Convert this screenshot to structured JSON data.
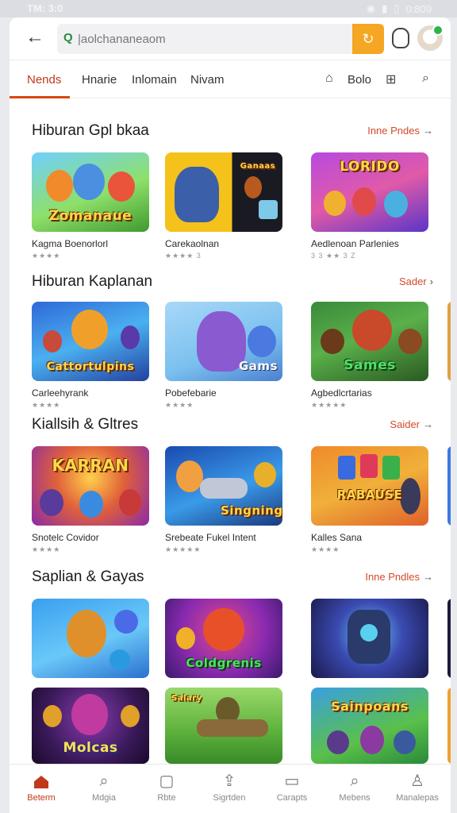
{
  "status_bar": {
    "time": "TM: 3:0",
    "clock": "0:809"
  },
  "browser": {
    "address": "|aolchananeaom",
    "address_icon": "Q"
  },
  "tabs": [
    {
      "label": "Nends",
      "active": true
    },
    {
      "label": "Hnarie",
      "active": false
    },
    {
      "label": "Inlomain",
      "active": false
    },
    {
      "label": "Nivam",
      "active": false
    }
  ],
  "tab_tools": {
    "home_label": "Bolo"
  },
  "sections": [
    {
      "title": "Hiburan Gpl bkaa",
      "link": "Inne Pndes",
      "cards": [
        {
          "title": "Kagma Boenorlorl",
          "rating": "★★★★",
          "art": "Zomanaue",
          "icon": "kingdom-game-icon"
        },
        {
          "title": "Carekaolnan",
          "rating": "★★★★ 3",
          "art": "Ganaas",
          "icon": "wolf-game-icon"
        },
        {
          "title": "Aedlenoan Parlenies",
          "rating": "3 3 ★★ 3 Z",
          "art": "LORIDO",
          "icon": "party-game-icon"
        }
      ]
    },
    {
      "title": "Hiburan Kaplanan",
      "link": "Sader",
      "cards": [
        {
          "title": "Carleehyrank",
          "rating": "★★★★",
          "art": "Cattortulpins",
          "icon": "hero-game-icon"
        },
        {
          "title": "Pobefebarie",
          "rating": "★★★★",
          "art": "Gams",
          "icon": "cat-game-icon"
        },
        {
          "title": "Agbedlcrtarias",
          "rating": "★★★★★",
          "art": "Sames",
          "icon": "dragon-game-icon"
        }
      ]
    },
    {
      "title": "Kiallsih & Gltres",
      "link": "Saider",
      "cards": [
        {
          "title": "Snotelc Covidor",
          "rating": "★★★★",
          "art": "KARRAN",
          "icon": "arena-game-icon"
        },
        {
          "title": "Srebeate Fukel Intent",
          "rating": "★★★★★",
          "art": "Singning",
          "icon": "cannon-game-icon"
        },
        {
          "title": "Kalles Sana",
          "rating": "★★★★",
          "art": "RABAUSE",
          "icon": "cards-game-icon"
        }
      ]
    },
    {
      "title": "Saplian & Gayas",
      "link": "Inne Pndles",
      "cards": [
        {
          "title": "",
          "rating": "",
          "art": "",
          "icon": "squirrel-game-icon"
        },
        {
          "title": "",
          "rating": "",
          "art": "Coldgrenis",
          "icon": "monster-game-icon"
        },
        {
          "title": "",
          "rating": "",
          "art": "",
          "icon": "robot-game-icon"
        },
        {
          "title": "",
          "rating": "",
          "art": "Molcas",
          "icon": "witch-game-icon"
        },
        {
          "title": "",
          "rating": "",
          "art": "Salary",
          "icon": "soldier-game-icon"
        },
        {
          "title": "",
          "rating": "",
          "art": "Sainpoans",
          "icon": "battle-game-icon"
        }
      ]
    }
  ],
  "bottom_nav": [
    {
      "label": "Beterm",
      "icon": "home-icon",
      "active": true
    },
    {
      "label": "Mdgia",
      "icon": "search-icon",
      "active": false
    },
    {
      "label": "Rbte",
      "icon": "page-icon",
      "active": false
    },
    {
      "label": "Sigrtden",
      "icon": "share-icon",
      "active": false
    },
    {
      "label": "Carapts",
      "icon": "card-icon",
      "active": false
    },
    {
      "label": "Mebens",
      "icon": "search-icon",
      "active": false
    },
    {
      "label": "Manalepas",
      "icon": "profile-icon",
      "active": false
    }
  ],
  "colors": {
    "accent": "#d9480f",
    "address_action": "#f5a623"
  }
}
